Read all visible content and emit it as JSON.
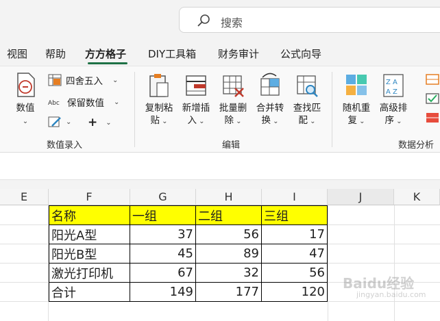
{
  "search": {
    "placeholder": "搜索"
  },
  "tabs": [
    "视图",
    "帮助",
    "方方格子",
    "DIY工具箱",
    "财务审计",
    "公式向导"
  ],
  "ribbon": {
    "numeric": {
      "big_button": [
        "数值"
      ],
      "round_label": "四舍五入",
      "keep_label": "保留数值",
      "plus": "+",
      "group_label": "数值录入"
    },
    "edit": {
      "buttons": [
        {
          "line1": "复制粘",
          "line2": "贴"
        },
        {
          "line1": "新增插",
          "line2": "入"
        },
        {
          "line1": "批量删",
          "line2": "除"
        },
        {
          "line1": "合并转",
          "line2": "换"
        },
        {
          "line1": "查找匹",
          "line2": "配"
        }
      ],
      "group_label": "编辑"
    },
    "analysis": {
      "buttons": [
        {
          "line1": "随机重",
          "line2": "复"
        },
        {
          "line1": "高级排",
          "line2": "序"
        }
      ],
      "group_label": "数据分析"
    }
  },
  "columns": [
    "E",
    "F",
    "G",
    "H",
    "I",
    "J",
    "K"
  ],
  "table": {
    "header": [
      "名称",
      "一组",
      "二组",
      "三组"
    ],
    "rows": [
      [
        "阳光A型",
        "37",
        "56",
        "17"
      ],
      [
        "阳光B型",
        "45",
        "89",
        "47"
      ],
      [
        "激光打印机",
        "67",
        "32",
        "56"
      ],
      [
        "合计",
        "149",
        "177",
        "120"
      ]
    ]
  },
  "watermark": {
    "text": "Baidu经验",
    "sub": "jingyan.baidu.com"
  }
}
